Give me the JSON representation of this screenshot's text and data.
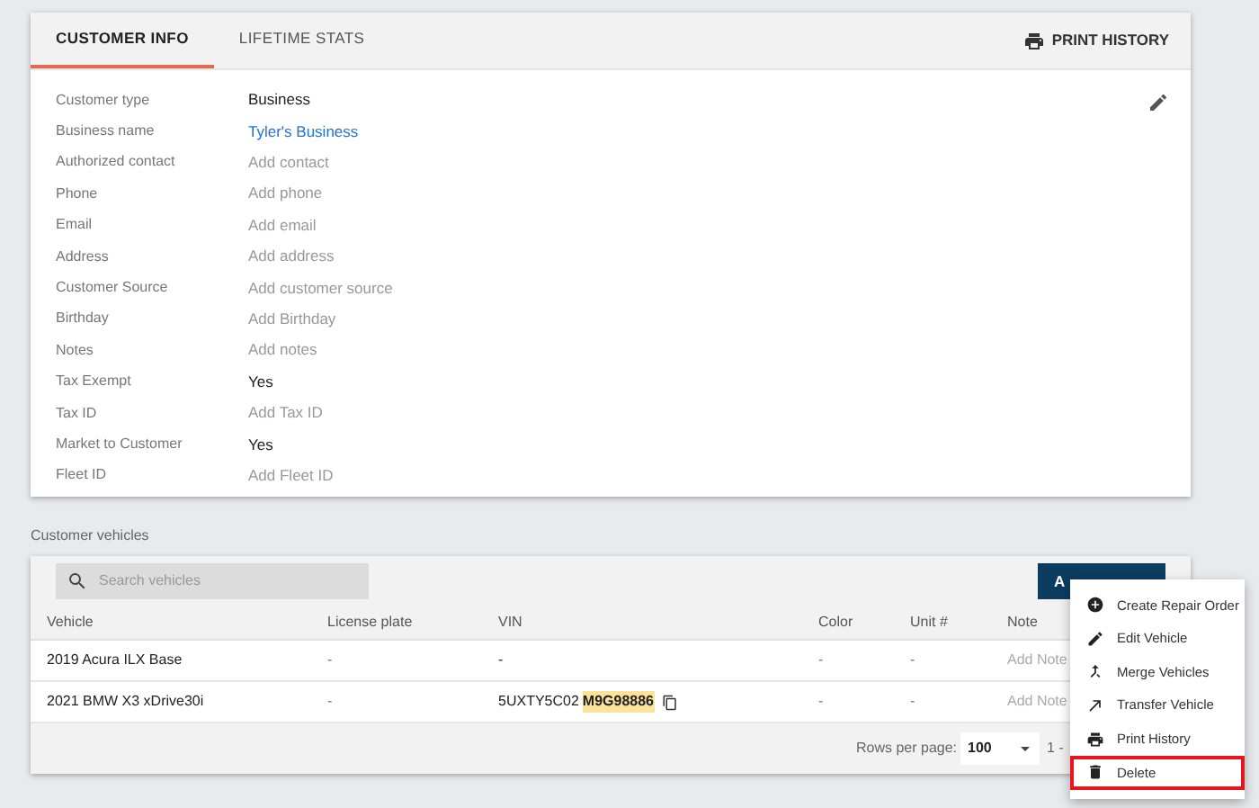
{
  "tabs": [
    {
      "label": "CUSTOMER INFO",
      "selected": true
    },
    {
      "label": "LIFETIME STATS",
      "selected": false
    }
  ],
  "print_history": "PRINT HISTORY",
  "fields": [
    {
      "label": "Customer type",
      "value": "Business",
      "kind": "value"
    },
    {
      "label": "Business name",
      "value": "Tyler's Business",
      "kind": "link"
    },
    {
      "label": "Authorized contact",
      "value": "Add contact",
      "kind": "empty"
    },
    {
      "label": "Phone",
      "value": "Add phone",
      "kind": "empty"
    },
    {
      "label": "Email",
      "value": "Add email",
      "kind": "empty"
    },
    {
      "label": "Address",
      "value": "Add address",
      "kind": "empty"
    },
    {
      "label": "Customer Source",
      "value": "Add customer source",
      "kind": "empty"
    },
    {
      "label": "Birthday",
      "value": "Add Birthday",
      "kind": "empty"
    },
    {
      "label": "Notes",
      "value": "Add notes",
      "kind": "empty"
    },
    {
      "label": "Tax Exempt",
      "value": "Yes",
      "kind": "value"
    },
    {
      "label": "Tax ID",
      "value": "Add Tax ID",
      "kind": "empty"
    },
    {
      "label": "Market to Customer",
      "value": "Yes",
      "kind": "value"
    },
    {
      "label": "Fleet ID",
      "value": "Add Fleet ID",
      "kind": "empty"
    }
  ],
  "vehicles_title": "Customer vehicles",
  "search": {
    "placeholder": "Search vehicles"
  },
  "add_button": "A",
  "table": {
    "columns": [
      "Vehicle",
      "License plate",
      "VIN",
      "Color",
      "Unit #",
      "Note"
    ],
    "rows": [
      {
        "vehicle": "2019 Acura ILX Base",
        "plate": "-",
        "vin": "-",
        "vin_match": "",
        "copy": false,
        "paint": "-",
        "unit": "-",
        "note": "Add Note"
      },
      {
        "vehicle": "2021 BMW X3 xDrive30i",
        "plate": "-",
        "vin": "5UXTY5C02",
        "vin_match": "M9G98886",
        "copy": true,
        "paint": "-",
        "unit": "-",
        "note": "Add Note"
      }
    ]
  },
  "pagination": {
    "rows_label": "Rows per page:",
    "rows_value": "100",
    "range": "1 -"
  },
  "menu": [
    {
      "label": "Create Repair Order",
      "kind": "create",
      "highlighted": false
    },
    {
      "label": "Edit Vehicle",
      "kind": "edit",
      "highlighted": false
    },
    {
      "label": "Merge Vehicles",
      "kind": "merge",
      "highlighted": false
    },
    {
      "label": "Transfer Vehicle",
      "kind": "transfer",
      "highlighted": false
    },
    {
      "label": "Print History",
      "kind": "print",
      "highlighted": false
    },
    {
      "label": "Delete",
      "kind": "delete",
      "highlighted": true
    }
  ]
}
